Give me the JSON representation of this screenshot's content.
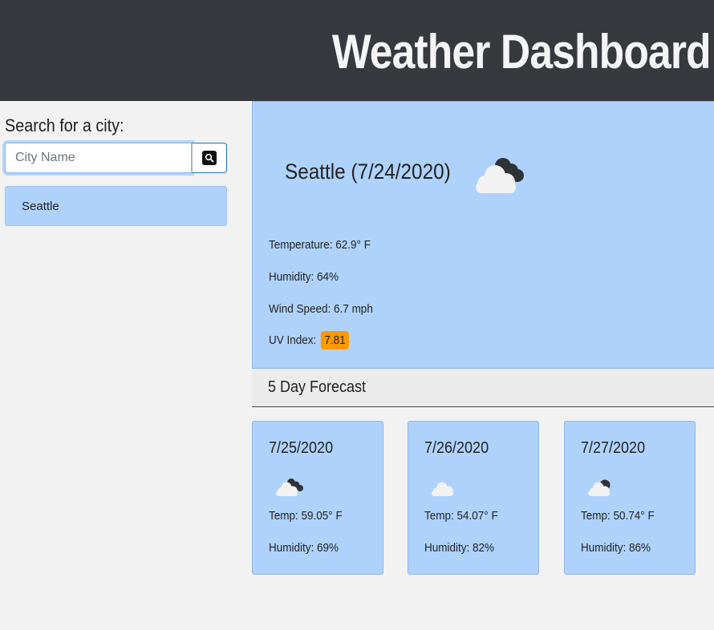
{
  "header": {
    "title": "Weather Dashboard"
  },
  "search": {
    "label": "Search for a city:",
    "placeholder": "City Name",
    "value": "",
    "button_icon": "search-icon"
  },
  "history": [
    {
      "label": "Seattle"
    }
  ],
  "current": {
    "title": "Seattle (7/24/2020)",
    "icon": "broken-clouds-icon",
    "temperature": "Temperature: 62.9° F",
    "humidity": "Humidity: 64%",
    "wind_speed": "Wind Speed: 6.7 mph",
    "uv_label": "UV Index:",
    "uv_value": "7.81",
    "uv_color": "#ff9900"
  },
  "forecast": {
    "heading": "5 Day Forecast",
    "days": [
      {
        "date": "7/25/2020",
        "icon": "broken-clouds-icon",
        "temp": "Temp: 59.05° F",
        "humidity": "Humidity: 69%"
      },
      {
        "date": "7/26/2020",
        "icon": "few-clouds-icon",
        "temp": "Temp: 54.07° F",
        "humidity": "Humidity: 82%"
      },
      {
        "date": "7/27/2020",
        "icon": "scattered-clouds-icon",
        "temp": "Temp: 50.74° F",
        "humidity": "Humidity: 86%"
      }
    ]
  },
  "colors": {
    "header_bg": "#363a3e",
    "card_bg": "#aed2fb",
    "page_bg": "#f2f2f2"
  }
}
